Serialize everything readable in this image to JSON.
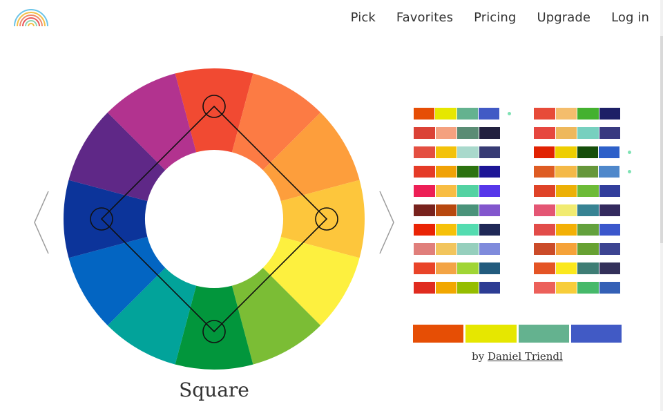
{
  "nav": {
    "items": [
      {
        "label": "Pick"
      },
      {
        "label": "Favorites"
      },
      {
        "label": "Pricing"
      },
      {
        "label": "Upgrade"
      },
      {
        "label": "Log in"
      }
    ]
  },
  "wheel": {
    "segment_colors": [
      "#f14a32",
      "#fc7b44",
      "#fd9e3c",
      "#fdc63c",
      "#fdf03f",
      "#7bbd35",
      "#02963c",
      "#02a39a",
      "#0365c2",
      "#0c349a",
      "#5f2887",
      "#b2338f"
    ],
    "selected_hues": [
      0,
      3,
      6,
      9
    ]
  },
  "scheme": {
    "name": "Square"
  },
  "palettes": {
    "left": [
      {
        "colors": [
          "#e64e05",
          "#e6e700",
          "#64b28f",
          "#415ac5"
        ],
        "dot": true
      },
      {
        "colors": [
          "#db4236",
          "#f4a17f",
          "#5a8c74",
          "#22213f"
        ],
        "dot": false
      },
      {
        "colors": [
          "#e44f41",
          "#f3c20a",
          "#a9d9cc",
          "#373b74"
        ],
        "dot": false
      },
      {
        "colors": [
          "#e53b27",
          "#f0a205",
          "#2c7210",
          "#1c1596"
        ],
        "dot": false
      },
      {
        "colors": [
          "#ed1f56",
          "#f8bd43",
          "#53d2a2",
          "#5637ea"
        ],
        "dot": false
      },
      {
        "colors": [
          "#78221d",
          "#b7480f",
          "#4a937a",
          "#8256cd"
        ],
        "dot": false
      },
      {
        "colors": [
          "#ea2405",
          "#f6c109",
          "#54dcb0",
          "#1f2857"
        ],
        "dot": false
      },
      {
        "colors": [
          "#e07f7b",
          "#f2c55d",
          "#96cfbd",
          "#7f8bdc"
        ],
        "dot": false
      },
      {
        "colors": [
          "#e94429",
          "#f3a445",
          "#a0d535",
          "#225b7e"
        ],
        "dot": false
      },
      {
        "colors": [
          "#e02b1f",
          "#f1a700",
          "#95bd00",
          "#2c3c94"
        ],
        "dot": false
      }
    ],
    "right": [
      {
        "colors": [
          "#e74b39",
          "#f4bd6c",
          "#44b12f",
          "#1d2066"
        ],
        "dot": false
      },
      {
        "colors": [
          "#e6473f",
          "#eeb85c",
          "#77d0bf",
          "#383a80"
        ],
        "dot": false
      },
      {
        "colors": [
          "#e12202",
          "#eece01",
          "#154e0a",
          "#2d60c9"
        ],
        "dot": true
      },
      {
        "colors": [
          "#de5c23",
          "#f4b947",
          "#66973b",
          "#4f88cb"
        ],
        "dot": true
      },
      {
        "colors": [
          "#df4328",
          "#ecb006",
          "#6dbb38",
          "#323e9c"
        ],
        "dot": false
      },
      {
        "colors": [
          "#e45674",
          "#f1eb71",
          "#378393",
          "#332a5e"
        ],
        "dot": false
      },
      {
        "colors": [
          "#e24c49",
          "#f3b005",
          "#63a13d",
          "#3b57cc"
        ],
        "dot": false
      },
      {
        "colors": [
          "#cb4b29",
          "#f5a239",
          "#67a133",
          "#3c4491"
        ],
        "dot": false
      },
      {
        "colors": [
          "#e45425",
          "#fbe81d",
          "#3e7d75",
          "#33305a"
        ],
        "dot": false
      },
      {
        "colors": [
          "#ec605a",
          "#f7cd3a",
          "#46b96a",
          "#3460b6"
        ],
        "dot": false
      }
    ]
  },
  "selected_palette": {
    "colors": [
      "#e64e05",
      "#e6e700",
      "#64b28f",
      "#415ac5"
    ]
  },
  "credit": {
    "prefix": "by",
    "author": "Daniel Triendl"
  }
}
